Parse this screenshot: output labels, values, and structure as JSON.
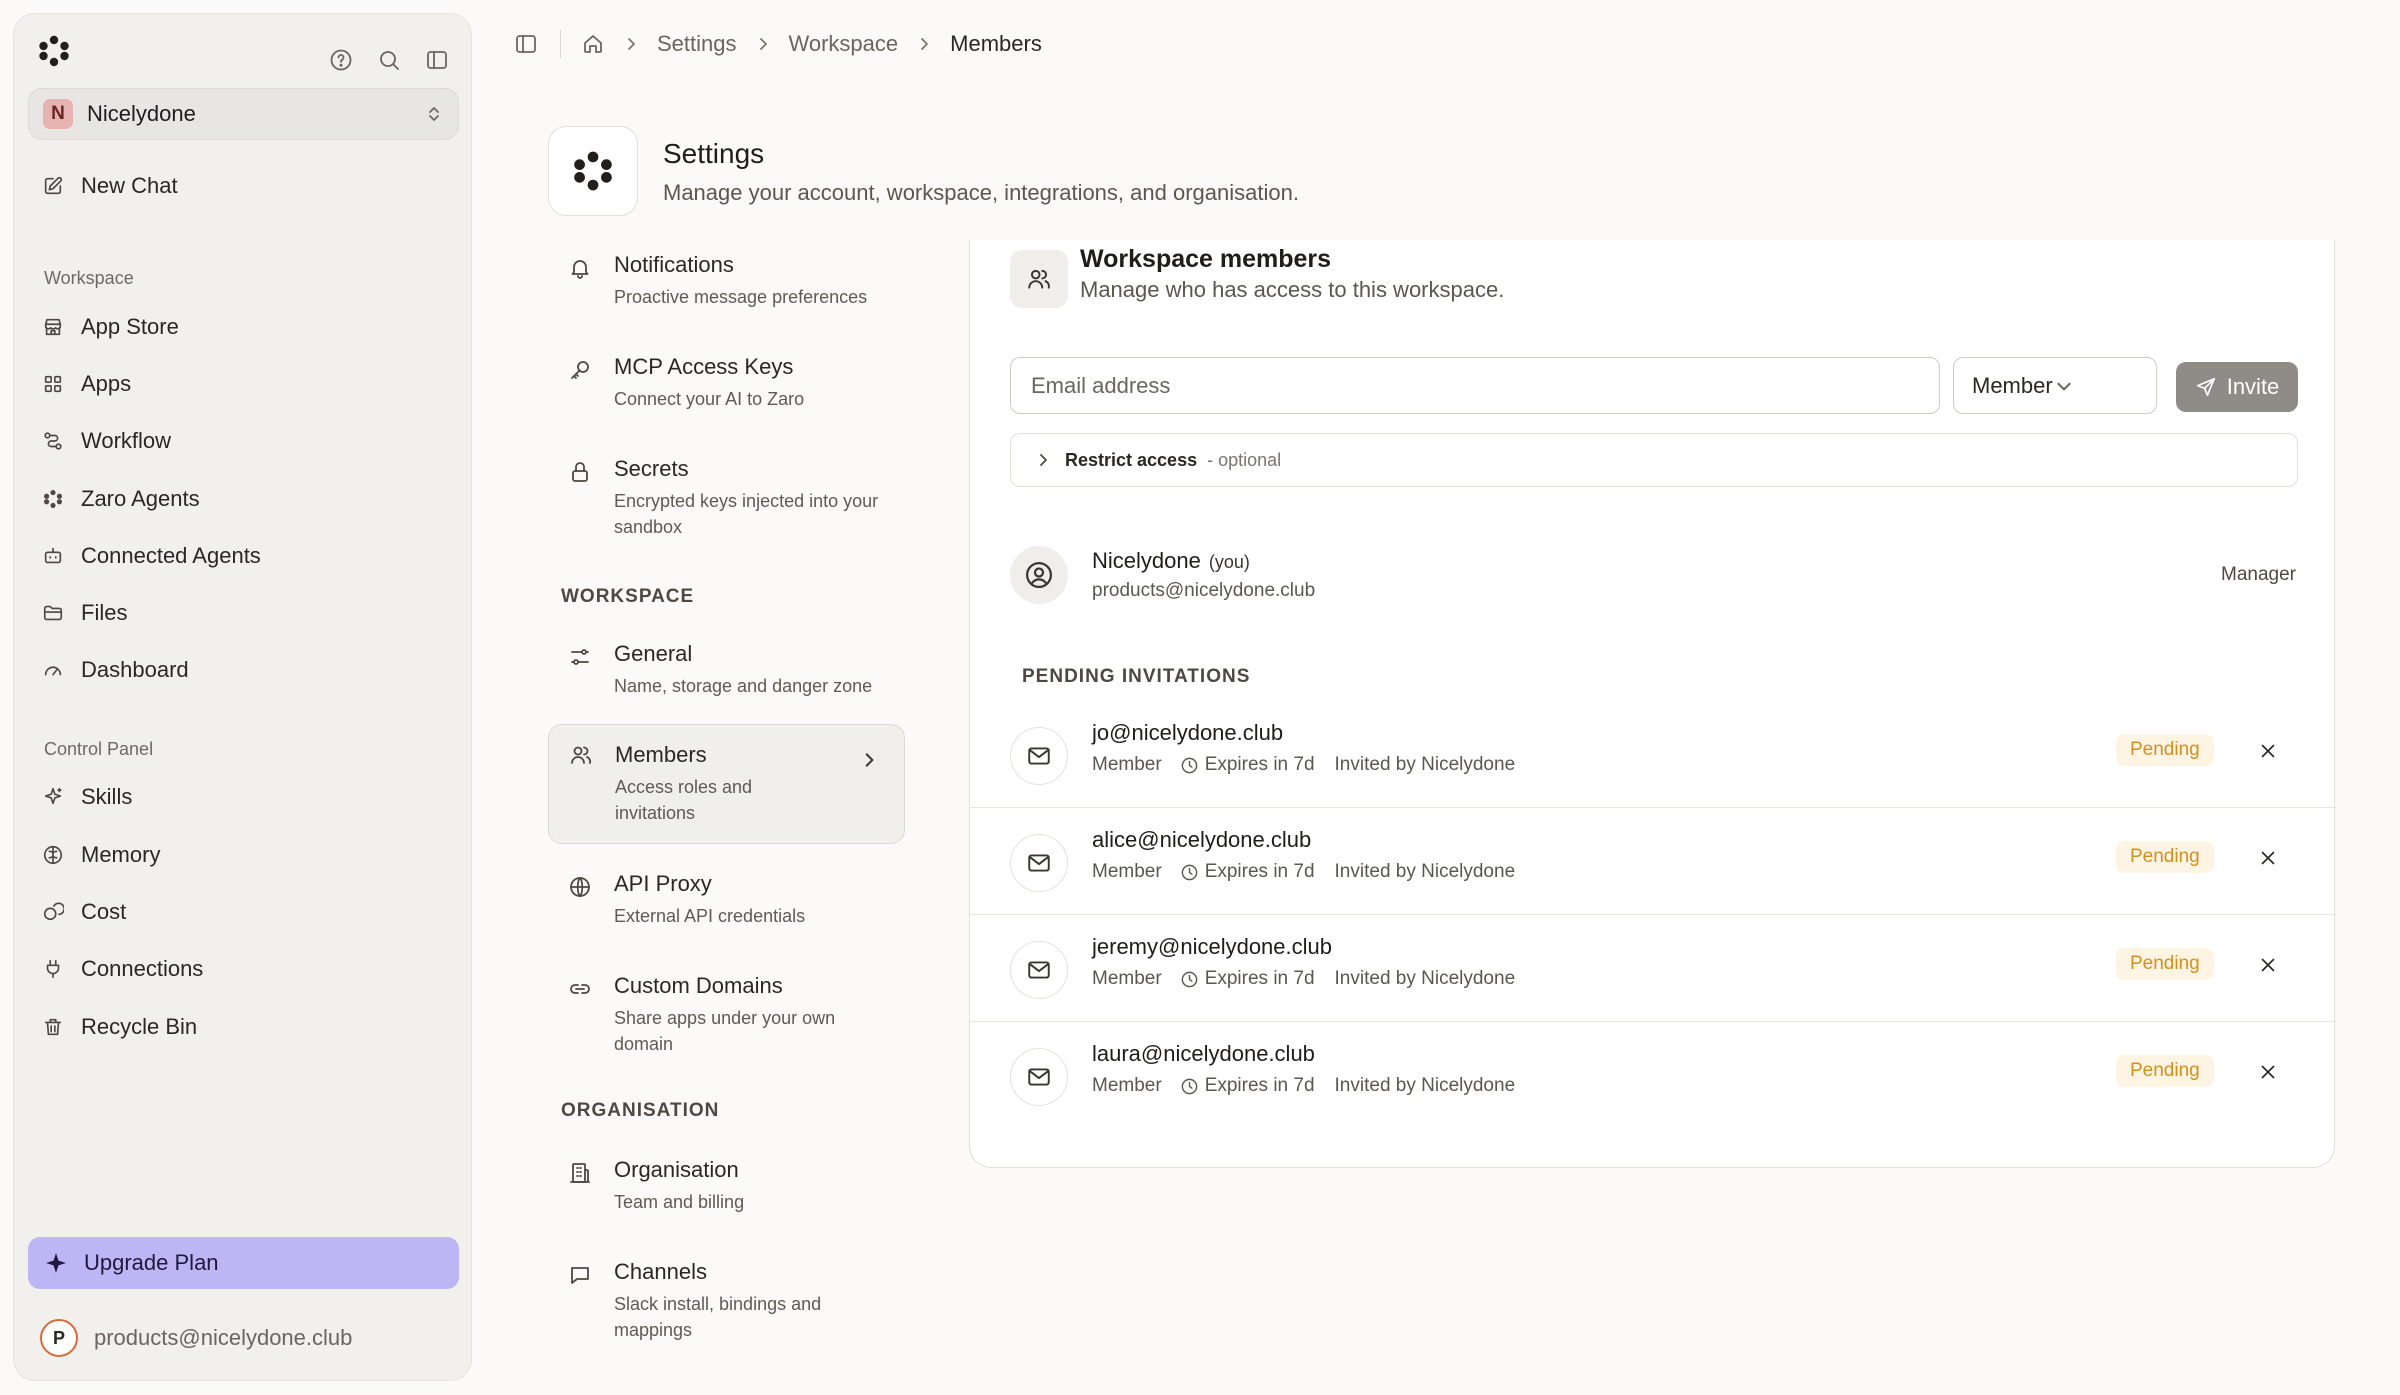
{
  "sidebar": {
    "workspace_initial": "N",
    "workspace_name": "Nicelydone",
    "new_chat": "New Chat",
    "section_workspace": "Workspace",
    "workspace_items": [
      {
        "label": "App Store",
        "icon": "store-icon"
      },
      {
        "label": "Apps",
        "icon": "grid-icon"
      },
      {
        "label": "Workflow",
        "icon": "workflow-icon"
      },
      {
        "label": "Zaro Agents",
        "icon": "agents-icon"
      },
      {
        "label": "Connected Agents",
        "icon": "bot-icon"
      },
      {
        "label": "Files",
        "icon": "folder-icon"
      },
      {
        "label": "Dashboard",
        "icon": "gauge-icon"
      }
    ],
    "section_control": "Control Panel",
    "control_items": [
      {
        "label": "Skills",
        "icon": "sparkle-icon"
      },
      {
        "label": "Memory",
        "icon": "brain-icon"
      },
      {
        "label": "Cost",
        "icon": "coins-icon"
      },
      {
        "label": "Connections",
        "icon": "plug-icon"
      },
      {
        "label": "Recycle Bin",
        "icon": "trash-icon"
      }
    ],
    "upgrade_label": "Upgrade Plan",
    "user_initial": "P",
    "user_email": "products@nicelydone.club"
  },
  "breadcrumb": {
    "items": [
      "Settings",
      "Workspace",
      "Members"
    ]
  },
  "settings": {
    "title": "Settings",
    "subtitle": "Manage your account, workspace, integrations, and organisation.",
    "nav_top": [
      {
        "title": "Notifications",
        "desc": "Proactive message preferences",
        "icon": "bell-icon"
      },
      {
        "title": "MCP Access Keys",
        "desc": "Connect your AI to Zaro",
        "icon": "key-icon"
      },
      {
        "title": "Secrets",
        "desc": "Encrypted keys injected into your sandbox",
        "icon": "lock-icon"
      }
    ],
    "section_workspace": "WORKSPACE",
    "nav_workspace": [
      {
        "title": "General",
        "desc": "Name, storage and danger zone",
        "icon": "sliders-icon"
      },
      {
        "title": "Members",
        "desc": "Access roles and invitations",
        "icon": "users-icon"
      },
      {
        "title": "API Proxy",
        "desc": "External API credentials",
        "icon": "globe-icon"
      },
      {
        "title": "Custom Domains",
        "desc": "Share apps under your own domain",
        "icon": "link-icon"
      }
    ],
    "section_organisation": "ORGANISATION",
    "nav_organisation": [
      {
        "title": "Organisation",
        "desc": "Team and billing",
        "icon": "building-icon"
      },
      {
        "title": "Channels",
        "desc": "Slack install, bindings and mappings",
        "icon": "chat-icon"
      }
    ]
  },
  "members_panel": {
    "title": "Workspace members",
    "subtitle": "Manage who has access to this workspace.",
    "email_placeholder": "Email address",
    "role_value": "Member",
    "invite_label": "Invite",
    "restrict_label": "Restrict access",
    "restrict_optional": "- optional",
    "current_member": {
      "name": "Nicelydone",
      "you": "(you)",
      "email": "products@nicelydone.club",
      "role": "Manager"
    },
    "pending_heading": "PENDING INVITATIONS",
    "invitations": [
      {
        "email": "jo@nicelydone.club",
        "role": "Member",
        "expires": "Expires in 7d",
        "invited_by": "Invited by Nicelydone",
        "status": "Pending"
      },
      {
        "email": "alice@nicelydone.club",
        "role": "Member",
        "expires": "Expires in 7d",
        "invited_by": "Invited by Nicelydone",
        "status": "Pending"
      },
      {
        "email": "jeremy@nicelydone.club",
        "role": "Member",
        "expires": "Expires in 7d",
        "invited_by": "Invited by Nicelydone",
        "status": "Pending"
      },
      {
        "email": "laura@nicelydone.club",
        "role": "Member",
        "expires": "Expires in 7d",
        "invited_by": "Invited by Nicelydone",
        "status": "Pending"
      }
    ]
  },
  "colors": {
    "accent_upgrade": "#bcb6f5",
    "pending_text": "#d4901e",
    "pending_bg": "#fdf4e3",
    "workspace_avatar": "#e7b3b0"
  }
}
